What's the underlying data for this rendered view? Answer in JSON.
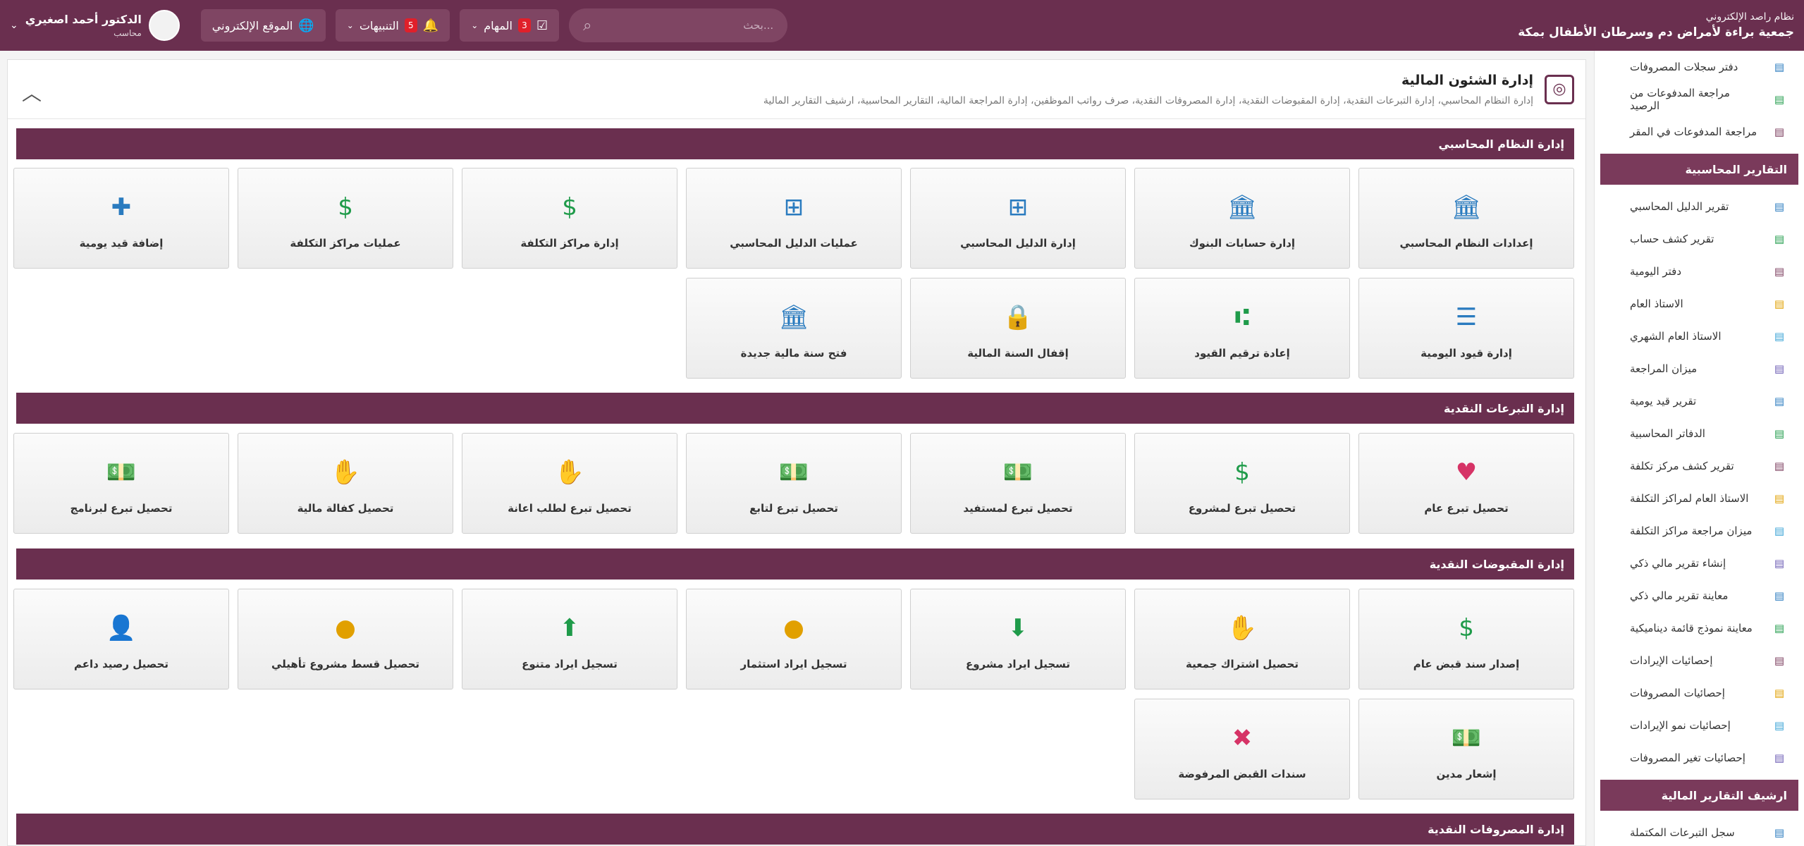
{
  "header": {
    "system_name": "نظام راصد الإلكتروني",
    "org_name": "جمعية براءة لأمراض دم وسرطان الأطفال بمكة",
    "search_placeholder": "بحث...",
    "tasks_label": "المهام",
    "tasks_count": "3",
    "alerts_label": "التنبيهات",
    "alerts_count": "5",
    "website_label": "الموقع الإلكتروني",
    "user_name": "الدكتور أحمد اصغيري",
    "user_role": "محاسب"
  },
  "sidebar": {
    "top_items": [
      {
        "label": "دفتر سجلات المصروفات",
        "icon": "ledger-icon"
      },
      {
        "label": "مراجعة المدفوعات من الرصيد",
        "icon": "payments-review-icon"
      },
      {
        "label": "مراجعة المدفوعات في المقر",
        "icon": "payments-hq-icon"
      }
    ],
    "section1": "التقارير المحاسبية",
    "reports": [
      {
        "label": "تقرير الدليل المحاسبي",
        "icon": "report-icon"
      },
      {
        "label": "تقرير كشف حساب",
        "icon": "calculator-icon"
      },
      {
        "label": "دفتر اليومية",
        "icon": "journal-icon"
      },
      {
        "label": "الاستاذ العام",
        "icon": "ledger-icon"
      },
      {
        "label": "الاستاذ العام الشهري",
        "icon": "monthly-ledger-icon"
      },
      {
        "label": "ميزان المراجعة",
        "icon": "balance-icon"
      },
      {
        "label": "تقرير قيد يومية",
        "icon": "entry-report-icon"
      },
      {
        "label": "الدفاتر المحاسبية",
        "icon": "books-icon"
      },
      {
        "label": "تقرير كشف مركز تكلفة",
        "icon": "cost-center-icon"
      },
      {
        "label": "الاستاذ العام لمراكز التكلفة",
        "icon": "cost-ledger-icon"
      },
      {
        "label": "ميزان مراجعة مراكز التكلفة",
        "icon": "cost-balance-icon"
      },
      {
        "label": "إنشاء تقرير مالي ذكي",
        "icon": "smart-report-icon"
      },
      {
        "label": "معاينة تقرير مالي ذكي",
        "icon": "preview-report-icon"
      },
      {
        "label": "معاينة نموذج قائمة ديناميكية",
        "icon": "dynamic-list-icon"
      },
      {
        "label": "إحصائيات الإيرادات",
        "icon": "revenue-stats-icon"
      },
      {
        "label": "إحصائيات المصروفات",
        "icon": "expense-stats-icon"
      },
      {
        "label": "إحصائيات نمو الإيرادات",
        "icon": "growth-chart-icon"
      },
      {
        "label": "إحصائيات تغير المصروفات",
        "icon": "trend-chart-icon"
      }
    ],
    "section2": "ارشيف التقارير المالية",
    "archive": [
      {
        "label": "سجل التبرعات المكتملة",
        "icon": "donations-log-icon"
      }
    ]
  },
  "panel": {
    "title": "إدارة الشئون المالية",
    "subtitle": "إدارة النظام المحاسبي، إدارة التبرعات النقدية، إدارة المقبوضات النقدية، إدارة المصروفات النقدية، صرف رواتب الموظفين، إدارة المراجعة المالية، التقارير المحاسبية، ارشيف التقارير المالية"
  },
  "sections": {
    "accounting": {
      "title": "إدارة النظام المحاسبي",
      "tiles": [
        {
          "label": "إعدادات النظام المحاسبي",
          "icon": "bank-settings-icon"
        },
        {
          "label": "إدارة حسابات البنوك",
          "icon": "bank-user-icon"
        },
        {
          "label": "إدارة الدليل المحاسبي",
          "icon": "tree-icon"
        },
        {
          "label": "عمليات الدليل المحاسبي",
          "icon": "tree-gear-icon"
        },
        {
          "label": "إدارة مراكز التكلفة",
          "icon": "cost-user-icon"
        },
        {
          "label": "عمليات مراكز التكلفة",
          "icon": "cost-gear-icon"
        },
        {
          "label": "إضافة قيد يومية",
          "icon": "add-entry-icon"
        },
        {
          "label": "إدارة قيود اليومية",
          "icon": "entries-icon"
        },
        {
          "label": "إعادة ترقيم القيود",
          "icon": "renumber-icon"
        },
        {
          "label": "إقفال السنة المالية",
          "icon": "lock-year-icon"
        },
        {
          "label": "فتح سنة مالية جديدة",
          "icon": "open-year-icon"
        }
      ]
    },
    "donations": {
      "title": "إدارة التبرعات النقدية",
      "tiles": [
        {
          "label": "تحصيل تبرع عام",
          "icon": "heart-money-icon"
        },
        {
          "label": "تحصيل تبرع لمشروع",
          "icon": "money-bag-icon"
        },
        {
          "label": "تحصيل تبرع لمستفيد",
          "icon": "beneficiary-money-icon"
        },
        {
          "label": "تحصيل تبرع لتابع",
          "icon": "cash-stack-icon"
        },
        {
          "label": "تحصيل تبرع لطلب اعانة",
          "icon": "hand-coin-icon"
        },
        {
          "label": "تحصيل كفالة مالية",
          "icon": "sponsor-icon"
        },
        {
          "label": "تحصيل تبرع لبرنامج",
          "icon": "program-money-icon"
        }
      ]
    },
    "receipts": {
      "title": "إدارة المقبوضات النقدية",
      "tiles": [
        {
          "label": "إصدار سند قبض عام",
          "icon": "receipt-icon"
        },
        {
          "label": "تحصيل اشتراك جمعية",
          "icon": "subscription-icon"
        },
        {
          "label": "تسجيل ايراد مشروع",
          "icon": "project-revenue-icon"
        },
        {
          "label": "تسجيل ايراد استثمار",
          "icon": "investment-icon"
        },
        {
          "label": "تسجيل ايراد متنوع",
          "icon": "misc-revenue-icon"
        },
        {
          "label": "تحصيل قسط مشروع تأهيلي",
          "icon": "coins-icon"
        },
        {
          "label": "تحصيل رصيد داعم",
          "icon": "supporter-icon"
        },
        {
          "label": "إشعار مدين",
          "icon": "debit-note-icon"
        },
        {
          "label": "سندات القبض المرفوضة",
          "icon": "rejected-receipt-icon"
        }
      ]
    },
    "expenses": {
      "title": "إدارة المصروفات النقدية"
    }
  }
}
